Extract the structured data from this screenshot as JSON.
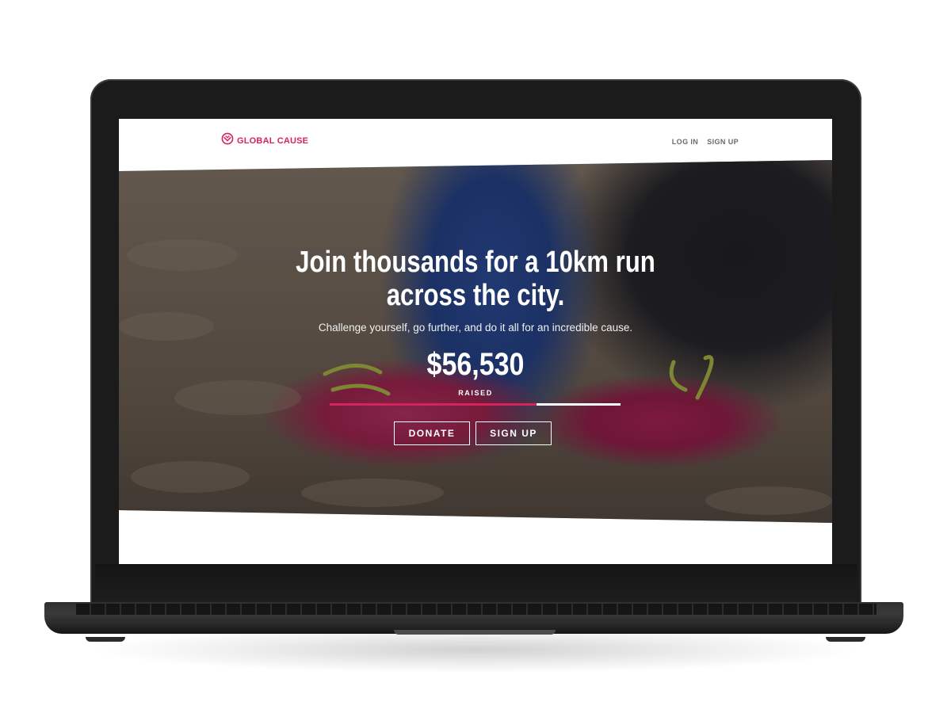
{
  "brand": {
    "name": "GLOBAL CAUSE",
    "accent": "#d6235b",
    "icon": "globe-heart-icon"
  },
  "nav": {
    "login": "LOG IN",
    "signup": "SIGN UP"
  },
  "hero": {
    "headline": "Join thousands for a 10km run across the city.",
    "subline": "Challenge yourself, go further, and do it all for an incredible cause.",
    "amount": "$56,530",
    "amount_label": "RAISED",
    "progress_percent": 71,
    "buttons": {
      "donate": "DONATE",
      "signup": "SIGN UP"
    }
  }
}
